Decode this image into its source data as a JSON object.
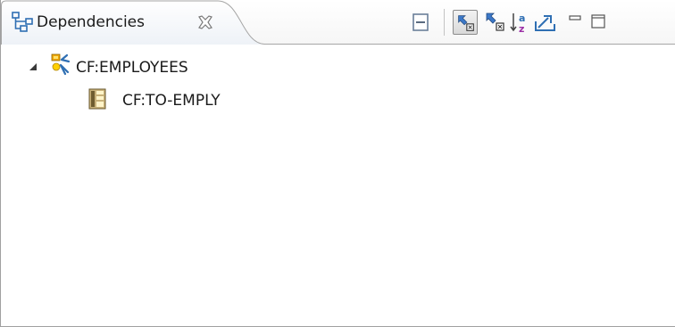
{
  "view": {
    "tab_title": "Dependencies",
    "tab_icon": "hierarchy-icon",
    "toolbar": [
      {
        "name": "collapse-all",
        "icon": "collapse-all-icon"
      },
      {
        "name": "show-callers",
        "icon": "show-callers-icon",
        "active": true
      },
      {
        "name": "show-callees",
        "icon": "show-callees-icon"
      },
      {
        "name": "sort-alphabetically",
        "icon": "sort-az-icon"
      },
      {
        "name": "export",
        "icon": "export-icon"
      },
      {
        "name": "minimize",
        "icon": "minimize-icon"
      },
      {
        "name": "maximize",
        "icon": "maximize-icon"
      }
    ]
  },
  "tree": {
    "root": {
      "label": "CF:EMPLOYEES",
      "icon": "data-node-icon",
      "expanded": true
    },
    "children": [
      {
        "label": "CF:TO-EMPLY",
        "icon": "table-icon"
      }
    ]
  }
}
